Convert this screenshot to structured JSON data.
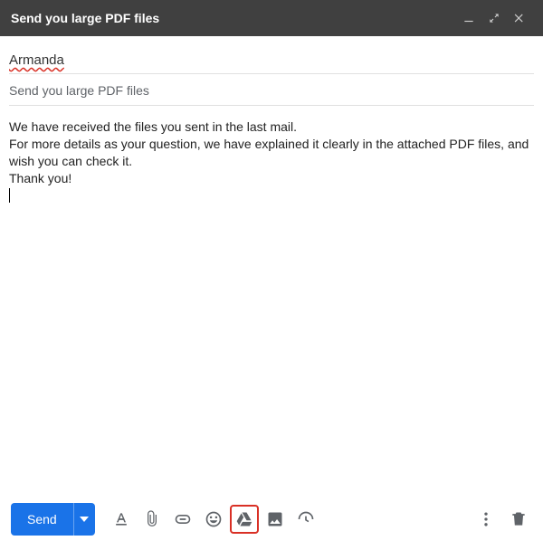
{
  "window": {
    "title": "Send you large PDF files"
  },
  "compose": {
    "to": "Armanda",
    "subject": "Send you large PDF files",
    "body": "We have received the files you sent in the last mail.\nFor more details as your question, we have explained it clearly in the attached PDF files, and wish you can check it.\nThank you!"
  },
  "toolbar": {
    "send_label": "Send"
  },
  "icons": {
    "format": "formatting-options",
    "attach": "attach-files",
    "link": "insert-link",
    "emoji": "insert-emoji",
    "drive": "insert-from-drive",
    "photo": "insert-photo",
    "confidential": "confidential-mode",
    "more": "more-options",
    "trash": "discard-draft"
  }
}
